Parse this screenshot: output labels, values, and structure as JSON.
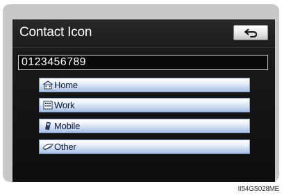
{
  "screen": {
    "title": "Contact Icon",
    "back_icon": "back-arrow-icon",
    "number_value": "0123456789"
  },
  "options": [
    {
      "label": "Home",
      "icon": "home-icon"
    },
    {
      "label": "Work",
      "icon": "work-icon"
    },
    {
      "label": "Mobile",
      "icon": "mobile-icon"
    },
    {
      "label": "Other",
      "icon": "other-icon"
    }
  ],
  "figure": {
    "code": "II54GS028ME"
  },
  "colors": {
    "screen_bg": "#0d0d0e",
    "button_blue_light": "#eef3fb",
    "button_blue_dark": "#a8bfe4",
    "button_text": "#0d1b33"
  }
}
